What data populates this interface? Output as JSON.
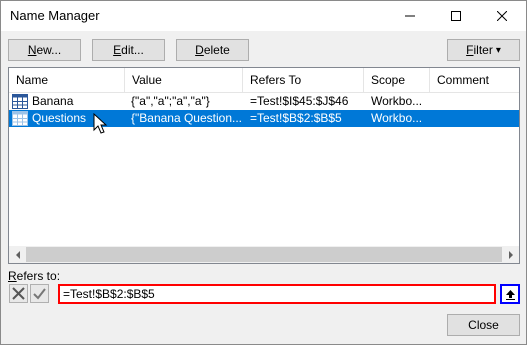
{
  "window": {
    "title": "Name Manager"
  },
  "icons": {
    "minimize": "minimize-icon",
    "maximize": "maximize-icon",
    "close": "close-icon",
    "range": "range-grid-icon",
    "cancel": "cancel-x-icon",
    "confirm": "checkmark-icon",
    "collapse": "collapse-dialog-icon",
    "cursor": "mouse-pointer-icon"
  },
  "toolbar": {
    "new_pre": "",
    "new_key": "N",
    "new_post": "ew...",
    "edit_pre": "",
    "edit_key": "E",
    "edit_post": "dit...",
    "delete_pre": "",
    "delete_key": "D",
    "delete_post": "elete",
    "filter_pre": "",
    "filter_key": "F",
    "filter_post": "ilter",
    "filter_arrow": "▾"
  },
  "columns": [
    "Name",
    "Value",
    "Refers To",
    "Scope",
    "Comment"
  ],
  "rows": [
    {
      "name": "Banana",
      "value": "{\"a\",\"a\";\"a\",\"a\"}",
      "refers_to": "=Test!$I$45:$J$46",
      "scope": "Workbo..."
    },
    {
      "name": "Questions",
      "value": "{\"Banana Question...",
      "refers_to": "=Test!$B$2:$B$5",
      "scope": "Workbo...",
      "selected": true
    }
  ],
  "refers": {
    "label_pre": "",
    "label_key": "R",
    "label_post": "efers to:",
    "value": "=Test!$B$2:$B$5"
  },
  "footer": {
    "close_label": "Close"
  },
  "colors": {
    "selection": "#0078d7",
    "refers_border": "#ff0000",
    "collapse_border": "#0000ff"
  }
}
